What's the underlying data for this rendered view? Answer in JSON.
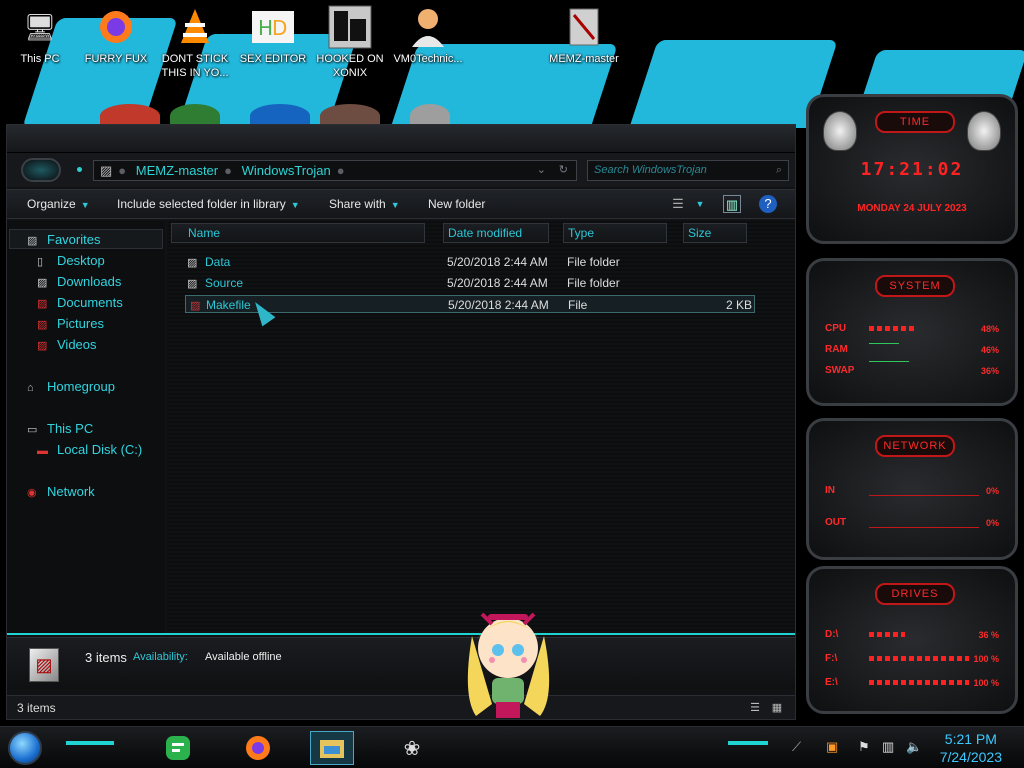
{
  "desktop_icons": [
    {
      "label": "This PC",
      "icon": "this-pc-icon"
    },
    {
      "label": "FURRY FUX",
      "icon": "firefox-icon"
    },
    {
      "label": "DONT STICK THIS IN YO...",
      "icon": "vlc-icon"
    },
    {
      "label": "SEX EDITOR",
      "icon": "hxd-icon"
    },
    {
      "label": "HOOKED ON XONIX",
      "icon": "xonix-icon"
    },
    {
      "label": "VM0Technic...",
      "icon": "user-icon"
    },
    {
      "label": "MEMZ-master",
      "icon": "folder-icon"
    }
  ],
  "explorer": {
    "breadcrumb": [
      "MEMZ-master",
      "WindowsTrojan"
    ],
    "search_placeholder": "Search WindowsTrojan",
    "toolbar": {
      "organize": "Organize",
      "include": "Include selected folder in library",
      "share": "Share with",
      "new_folder": "New folder"
    },
    "sidebar": {
      "favorites": "Favorites",
      "fav_items": [
        "Desktop",
        "Downloads",
        "Documents",
        "Pictures",
        "Videos"
      ],
      "homegroup": "Homegroup",
      "this_pc": "This PC",
      "local_disk": "Local Disk (C:)",
      "network": "Network"
    },
    "columns": {
      "name": "Name",
      "date": "Date modified",
      "type": "Type",
      "size": "Size"
    },
    "files": [
      {
        "name": "Data",
        "date": "5/20/2018 2:44 AM",
        "type": "File folder",
        "size": ""
      },
      {
        "name": "Source",
        "date": "5/20/2018 2:44 AM",
        "type": "File folder",
        "size": ""
      },
      {
        "name": "Makefile",
        "date": "5/20/2018 2:44 AM",
        "type": "File",
        "size": "2 KB"
      }
    ],
    "details": {
      "count": "3 items",
      "availability_label": "Availability:",
      "availability_value": "Available offline"
    },
    "status": "3 items"
  },
  "gadgets": {
    "time": {
      "title": "TIME",
      "time": "17:21:02",
      "date": "MONDAY 24 JULY 2023"
    },
    "system": {
      "title": "SYSTEM",
      "cpu_label": "CPU",
      "cpu": "48%",
      "cpu_frac": 0.48,
      "ram_label": "RAM",
      "ram": "46%",
      "swap_label": "SWAP",
      "swap": "36%"
    },
    "network": {
      "title": "NETWORK",
      "in_label": "IN",
      "in": "0%",
      "out_label": "OUT",
      "out": "0%"
    },
    "drives": {
      "title": "DRIVES",
      "items": [
        {
          "label": "D:\\",
          "value": "36 %",
          "frac": 0.36
        },
        {
          "label": "F:\\",
          "value": "100 %",
          "frac": 1.0
        },
        {
          "label": "E:\\",
          "value": "100 %",
          "frac": 1.0
        }
      ]
    }
  },
  "taskbar": {
    "time": "5:21 PM",
    "date": "7/24/2023"
  },
  "colors": {
    "accent": "#2ed3d3",
    "gadget_red": "#ff2222",
    "address_text": "#2ed3d3"
  }
}
